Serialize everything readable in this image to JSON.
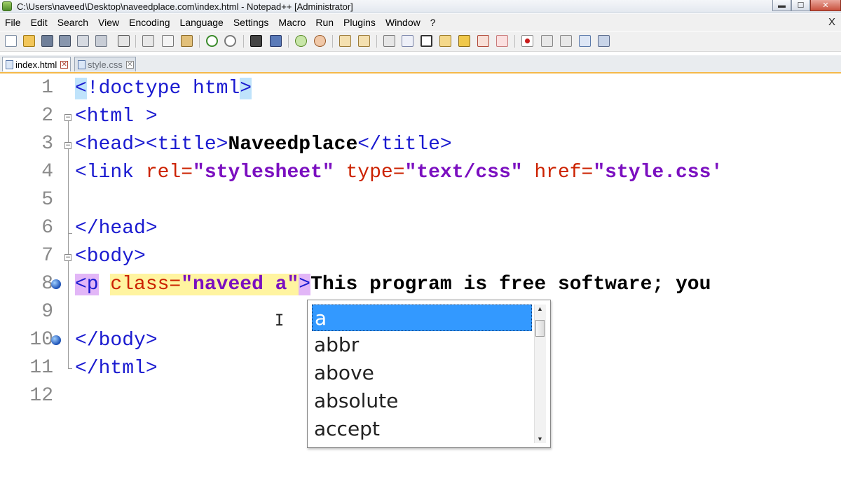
{
  "window": {
    "title": "C:\\Users\\naveed\\Desktop\\naveedplace.com\\index.html - Notepad++ [Administrator]",
    "controls": [
      "minimize",
      "maximize",
      "close"
    ]
  },
  "menu": {
    "items": [
      "File",
      "Edit",
      "Search",
      "View",
      "Encoding",
      "Language",
      "Settings",
      "Macro",
      "Run",
      "Plugins",
      "Window",
      "?"
    ],
    "doc_close": "X"
  },
  "toolbar": {
    "buttons": [
      "new-file-icon",
      "open-file-icon",
      "save-icon",
      "save-all-icon",
      "close-file-icon",
      "close-all-icon",
      "print-icon",
      "cut-icon",
      "copy-icon",
      "paste-icon",
      "undo-icon",
      "redo-icon",
      "find-icon",
      "replace-icon",
      "zoom-in-icon",
      "zoom-out-icon",
      "sync-vertical-icon",
      "sync-horizontal-icon",
      "word-wrap-icon",
      "show-all-chars-icon",
      "indent-guide-icon",
      "user-lang-icon",
      "doc-map-icon",
      "function-list-icon",
      "folder-as-workspace-icon",
      "record-macro-icon",
      "stop-record-icon",
      "play-macro-icon",
      "play-multiple-icon",
      "save-macro-icon"
    ]
  },
  "tabs": [
    {
      "label": "index.html",
      "active": true
    },
    {
      "label": "style.css",
      "active": false
    }
  ],
  "editor": {
    "line_numbers": [
      "1",
      "2",
      "3",
      "4",
      "5",
      "6",
      "7",
      "8",
      "9",
      "10",
      "11",
      "12"
    ],
    "lines": {
      "l1": {
        "open": "<",
        "bang": "!",
        "rest": "doctype html",
        "close": ">"
      },
      "l2": {
        "tag": "<html >"
      },
      "l3": {
        "head_open": "<head>",
        "title_open": "<title>",
        "title_text": "Naveedplace",
        "title_close": "</title>"
      },
      "l4": {
        "tag_open": "<link ",
        "rel_attr": "rel=",
        "rel_val": "\"stylesheet\"",
        "type_attr": " type=",
        "type_val": "\"text/css\"",
        "href_attr": " href=",
        "href_val": "\"style.css'"
      },
      "l6": {
        "tag": "</head>"
      },
      "l7": {
        "tag": "<body>"
      },
      "l8": {
        "tag_open": "<p",
        "space": " ",
        "class_attr": "class=",
        "class_val": "\"naveed a\"",
        "tag_close": ">",
        "text": "This program is free software; you"
      },
      "l10": {
        "tag": "</body>"
      },
      "l11": {
        "tag": "</html>"
      }
    }
  },
  "autocomplete": {
    "items": [
      "a",
      "abbr",
      "above",
      "absolute",
      "accept"
    ],
    "selected_index": 0
  },
  "colors": {
    "tag": "#1a1ad0",
    "attribute": "#cc2200",
    "value": "#7b0fc0",
    "selection": "#3399ff",
    "tab_accent": "#f5b94a"
  }
}
